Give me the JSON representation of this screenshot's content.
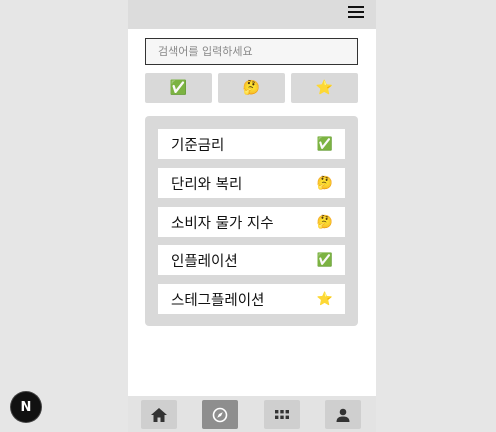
{
  "search": {
    "placeholder": "검색어를 입력하세요"
  },
  "filters": [
    {
      "name": "known",
      "icon": "✅"
    },
    {
      "name": "unsure",
      "icon": "🤔"
    },
    {
      "name": "starred",
      "icon": "⭐"
    }
  ],
  "terms": [
    {
      "label": "기준금리",
      "icon": "✅"
    },
    {
      "label": "단리와 복리",
      "icon": "🤔"
    },
    {
      "label": "소비자 물가 지수",
      "icon": "🤔"
    },
    {
      "label": "인플레이션",
      "icon": "✅"
    },
    {
      "label": "스테그플레이션",
      "icon": "⭐"
    }
  ],
  "nav": {
    "items": [
      "home-icon",
      "compass-icon",
      "apps-grid-icon",
      "profile-icon"
    ],
    "active": "compass-icon"
  },
  "badge": {
    "letter": "N"
  }
}
